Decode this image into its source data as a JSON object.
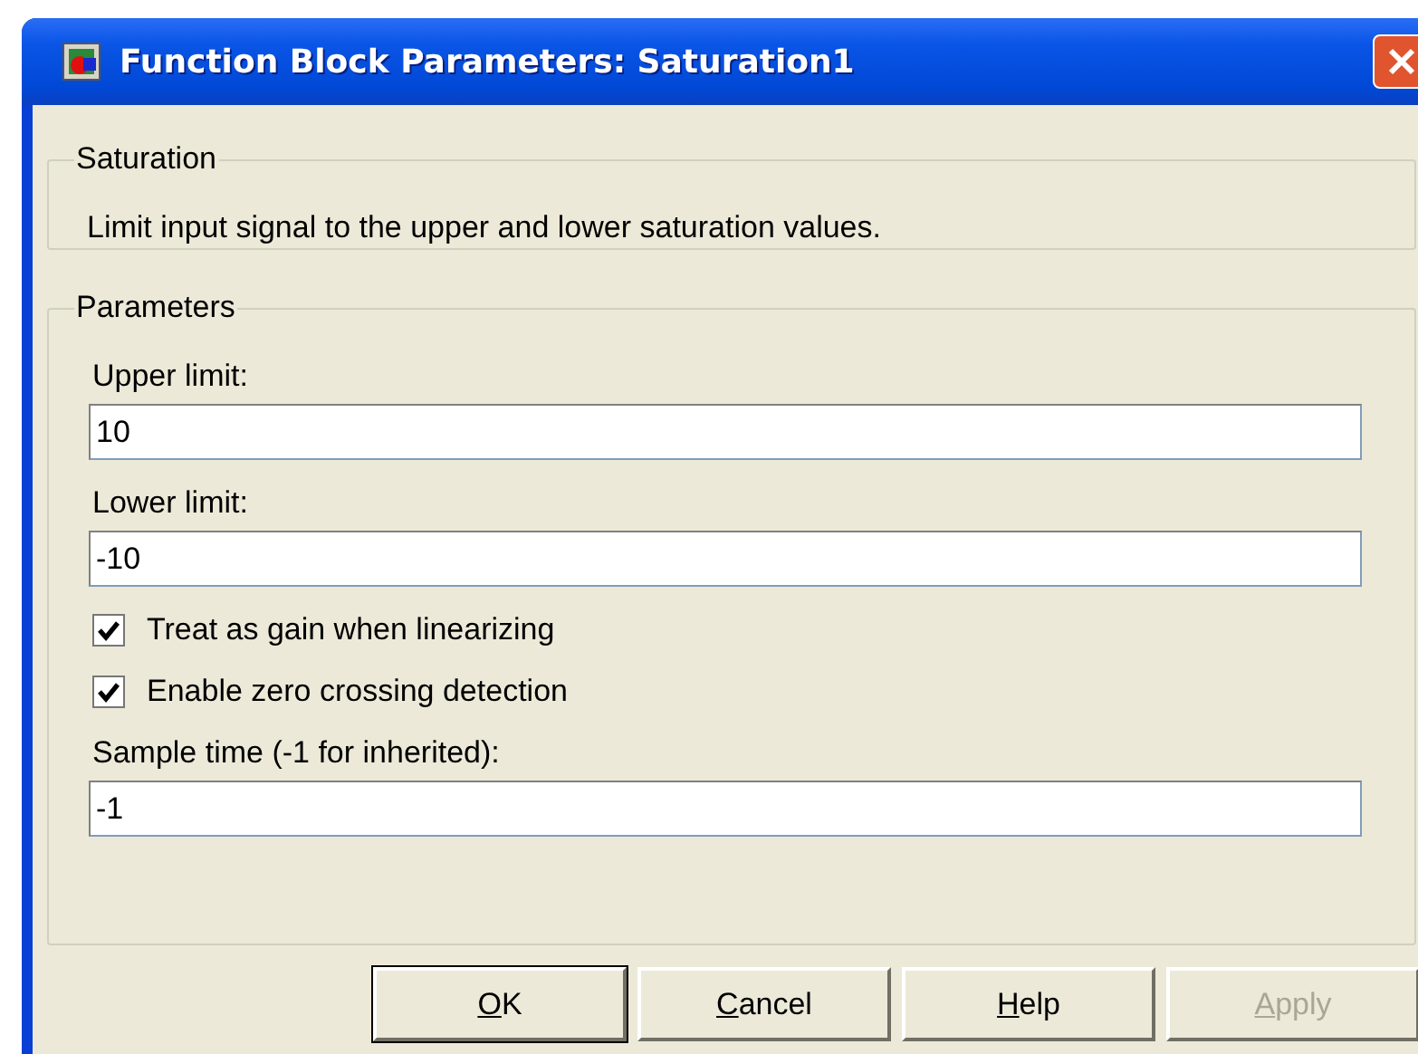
{
  "window": {
    "title": "Function Block Parameters: Saturation1"
  },
  "description_group": {
    "title": "Saturation",
    "text": "Limit input signal to the upper and lower saturation values."
  },
  "parameters_group": {
    "title": "Parameters",
    "items": [
      {
        "kind": "field",
        "label": "Upper limit:",
        "value": "10"
      },
      {
        "kind": "field",
        "label": "Lower limit:",
        "value": "-10"
      },
      {
        "kind": "checkbox",
        "label": "Treat as gain when linearizing",
        "checked": true
      },
      {
        "kind": "checkbox",
        "label": "Enable zero crossing detection",
        "checked": true
      },
      {
        "kind": "field",
        "label": "Sample time (-1 for inherited):",
        "value": "-1"
      }
    ]
  },
  "buttons": [
    {
      "label": "OK",
      "disabled": false
    },
    {
      "label": "Cancel",
      "disabled": false
    },
    {
      "label": "Help",
      "disabled": false
    },
    {
      "label": "Apply",
      "disabled": true
    }
  ]
}
